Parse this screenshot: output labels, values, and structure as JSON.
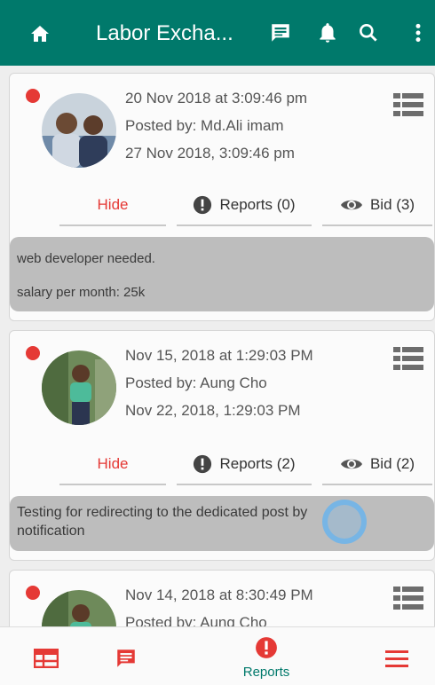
{
  "appbar": {
    "title": "Labor Excha...",
    "icons": [
      "home-icon",
      "message-icon",
      "bell-icon",
      "search-icon",
      "overflow-menu-icon"
    ]
  },
  "posts": [
    {
      "date": "20 Nov 2018 at 3:09:46 pm",
      "posted_by": "Posted by: Md.Ali imam",
      "expires": "27 Nov 2018, 3:09:46 pm",
      "hide_label": "Hide",
      "reports_label": "Reports (0)",
      "bid_label": "Bid (3)",
      "message_line1": "web developer needed.",
      "message_line2": "salary per month: 25k"
    },
    {
      "date": "Nov 15, 2018 at 1:29:03 PM",
      "posted_by": "Posted by: Aung Cho",
      "expires": "Nov 22, 2018, 1:29:03 PM",
      "hide_label": "Hide",
      "reports_label": "Reports (2)",
      "bid_label": "Bid (2)",
      "message_line1": "Testing for redirecting to the dedicated post by",
      "message_line2": "notification"
    },
    {
      "date": "Nov 14, 2018 at 8:30:49 PM",
      "posted_by": "Posted by: Aung Cho"
    }
  ],
  "bottom_nav": {
    "tabs": [
      {
        "icon": "calendar-table-icon",
        "label": ""
      },
      {
        "icon": "chat-icon",
        "label": ""
      },
      {
        "icon": "alert-circle-icon",
        "label": "Reports"
      },
      {
        "icon": "hamburger-menu-icon",
        "label": ""
      }
    ]
  },
  "colors": {
    "primary": "#00796b",
    "accent": "#e53935",
    "message_bg": "#bdbdbd"
  }
}
